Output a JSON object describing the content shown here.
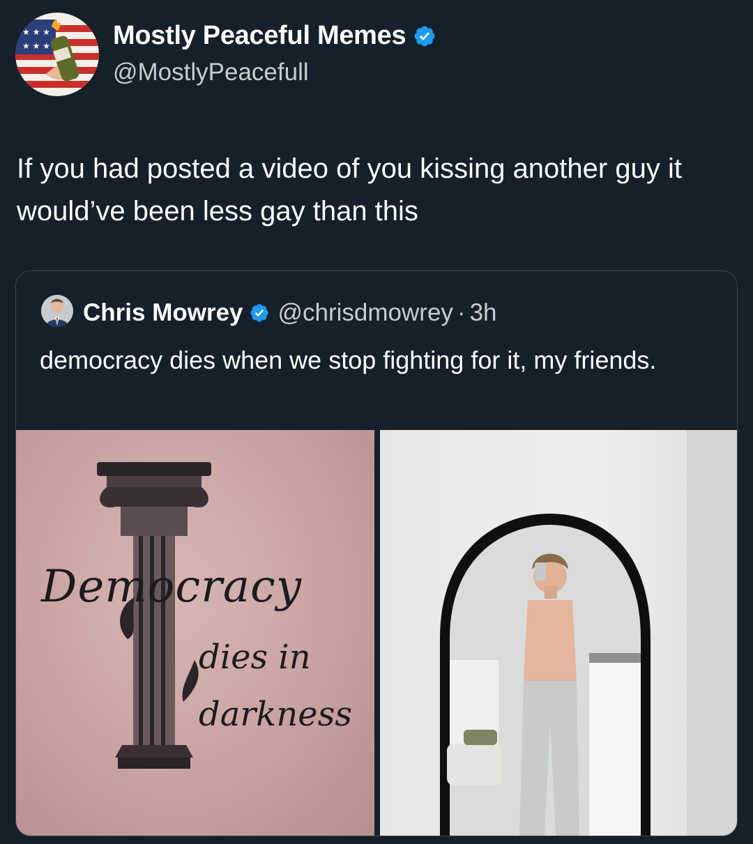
{
  "post": {
    "display_name": "Mostly Peaceful Memes",
    "handle": "@MostlyPeacefull",
    "text": "If you had posted a video of you kissing another guy it would’ve been less gay than this",
    "avatar_icon": "flag-molotov-avatar",
    "verified_icon": "verified-badge-icon"
  },
  "quoted": {
    "display_name": "Chris Mowrey",
    "handle": "@chrisdmowrey",
    "separator": "·",
    "time": "3h",
    "text": "democracy dies when we stop fighting for it, my friends.",
    "media": [
      {
        "kind": "photo",
        "description_icon": "column-tattoo-image",
        "overlay_text": [
          "Democracy",
          "dies in",
          "darkness"
        ]
      },
      {
        "kind": "photo",
        "description_icon": "mirror-selfie-image"
      }
    ]
  },
  "colors": {
    "background": "#15202b",
    "verified": "#1d9bf0",
    "secondary_text": "#c9ccd0",
    "border": "#38444d"
  }
}
